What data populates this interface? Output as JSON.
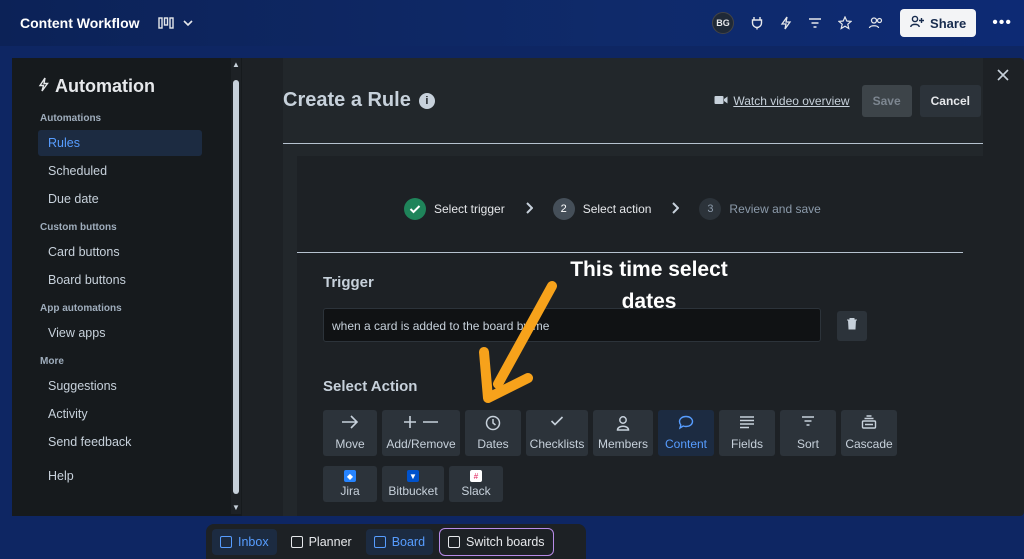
{
  "topbar": {
    "board_title": "Content Workflow",
    "avatar_initials": "BG",
    "share_label": "Share"
  },
  "sidebar": {
    "title": "Automation",
    "sections": [
      {
        "heading": "Automations",
        "items": [
          "Rules",
          "Scheduled",
          "Due date"
        ]
      },
      {
        "heading": "Custom buttons",
        "items": [
          "Card buttons",
          "Board buttons"
        ]
      },
      {
        "heading": "App automations",
        "items": [
          "View apps"
        ]
      },
      {
        "heading": "More",
        "items": [
          "Suggestions",
          "Activity",
          "Send feedback"
        ]
      }
    ],
    "help_label": "Help",
    "active_item": "Rules"
  },
  "main": {
    "title": "Create a Rule",
    "watch_video_label": "Watch video overview",
    "save_label": "Save",
    "cancel_label": "Cancel",
    "steps": [
      {
        "label": "Select trigger",
        "status": "done"
      },
      {
        "number": "2",
        "label": "Select action",
        "status": "active"
      },
      {
        "number": "3",
        "label": "Review and save",
        "status": "todo"
      }
    ],
    "trigger_heading": "Trigger",
    "trigger_text": "when a card is added to the board by me",
    "action_heading": "Select Action",
    "actions": [
      {
        "label": "Move",
        "icon": "arrow-right-icon"
      },
      {
        "label": "Add/Remove",
        "icon": "plus-minus-icon"
      },
      {
        "label": "Dates",
        "icon": "clock-icon"
      },
      {
        "label": "Checklists",
        "icon": "check-icon"
      },
      {
        "label": "Members",
        "icon": "person-icon"
      },
      {
        "label": "Content",
        "icon": "comment-icon",
        "selected": true
      },
      {
        "label": "Fields",
        "icon": "lines-icon"
      },
      {
        "label": "Sort",
        "icon": "sort-icon"
      },
      {
        "label": "Cascade",
        "icon": "cascade-icon"
      },
      {
        "label": "Jira",
        "icon": "jira-icon"
      },
      {
        "label": "Bitbucket",
        "icon": "bitbucket-icon"
      },
      {
        "label": "Slack",
        "icon": "slack-icon"
      }
    ]
  },
  "annotation": {
    "line1": "This time select",
    "line2": "dates",
    "color": "#f7a21b"
  },
  "bottombar": {
    "inbox_label": "Inbox",
    "planner_label": "Planner",
    "board_label": "Board",
    "switch_label": "Switch boards"
  },
  "colors": {
    "accent": "#579dff",
    "done_green": "#1f845a"
  }
}
